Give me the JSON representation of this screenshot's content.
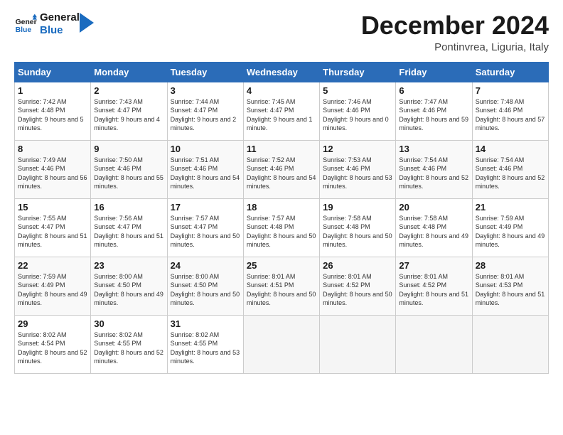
{
  "logo": {
    "text_general": "General",
    "text_blue": "Blue"
  },
  "header": {
    "month": "December 2024",
    "location": "Pontinvrea, Liguria, Italy"
  },
  "weekdays": [
    "Sunday",
    "Monday",
    "Tuesday",
    "Wednesday",
    "Thursday",
    "Friday",
    "Saturday"
  ],
  "weeks": [
    [
      {
        "day": "1",
        "sunrise": "7:42 AM",
        "sunset": "4:48 PM",
        "daylight": "9 hours and 5 minutes."
      },
      {
        "day": "2",
        "sunrise": "7:43 AM",
        "sunset": "4:47 PM",
        "daylight": "9 hours and 4 minutes."
      },
      {
        "day": "3",
        "sunrise": "7:44 AM",
        "sunset": "4:47 PM",
        "daylight": "9 hours and 2 minutes."
      },
      {
        "day": "4",
        "sunrise": "7:45 AM",
        "sunset": "4:47 PM",
        "daylight": "9 hours and 1 minute."
      },
      {
        "day": "5",
        "sunrise": "7:46 AM",
        "sunset": "4:46 PM",
        "daylight": "9 hours and 0 minutes."
      },
      {
        "day": "6",
        "sunrise": "7:47 AM",
        "sunset": "4:46 PM",
        "daylight": "8 hours and 59 minutes."
      },
      {
        "day": "7",
        "sunrise": "7:48 AM",
        "sunset": "4:46 PM",
        "daylight": "8 hours and 57 minutes."
      }
    ],
    [
      {
        "day": "8",
        "sunrise": "7:49 AM",
        "sunset": "4:46 PM",
        "daylight": "8 hours and 56 minutes."
      },
      {
        "day": "9",
        "sunrise": "7:50 AM",
        "sunset": "4:46 PM",
        "daylight": "8 hours and 55 minutes."
      },
      {
        "day": "10",
        "sunrise": "7:51 AM",
        "sunset": "4:46 PM",
        "daylight": "8 hours and 54 minutes."
      },
      {
        "day": "11",
        "sunrise": "7:52 AM",
        "sunset": "4:46 PM",
        "daylight": "8 hours and 54 minutes."
      },
      {
        "day": "12",
        "sunrise": "7:53 AM",
        "sunset": "4:46 PM",
        "daylight": "8 hours and 53 minutes."
      },
      {
        "day": "13",
        "sunrise": "7:54 AM",
        "sunset": "4:46 PM",
        "daylight": "8 hours and 52 minutes."
      },
      {
        "day": "14",
        "sunrise": "7:54 AM",
        "sunset": "4:46 PM",
        "daylight": "8 hours and 52 minutes."
      }
    ],
    [
      {
        "day": "15",
        "sunrise": "7:55 AM",
        "sunset": "4:47 PM",
        "daylight": "8 hours and 51 minutes."
      },
      {
        "day": "16",
        "sunrise": "7:56 AM",
        "sunset": "4:47 PM",
        "daylight": "8 hours and 51 minutes."
      },
      {
        "day": "17",
        "sunrise": "7:57 AM",
        "sunset": "4:47 PM",
        "daylight": "8 hours and 50 minutes."
      },
      {
        "day": "18",
        "sunrise": "7:57 AM",
        "sunset": "4:48 PM",
        "daylight": "8 hours and 50 minutes."
      },
      {
        "day": "19",
        "sunrise": "7:58 AM",
        "sunset": "4:48 PM",
        "daylight": "8 hours and 50 minutes."
      },
      {
        "day": "20",
        "sunrise": "7:58 AM",
        "sunset": "4:48 PM",
        "daylight": "8 hours and 49 minutes."
      },
      {
        "day": "21",
        "sunrise": "7:59 AM",
        "sunset": "4:49 PM",
        "daylight": "8 hours and 49 minutes."
      }
    ],
    [
      {
        "day": "22",
        "sunrise": "7:59 AM",
        "sunset": "4:49 PM",
        "daylight": "8 hours and 49 minutes."
      },
      {
        "day": "23",
        "sunrise": "8:00 AM",
        "sunset": "4:50 PM",
        "daylight": "8 hours and 49 minutes."
      },
      {
        "day": "24",
        "sunrise": "8:00 AM",
        "sunset": "4:50 PM",
        "daylight": "8 hours and 50 minutes."
      },
      {
        "day": "25",
        "sunrise": "8:01 AM",
        "sunset": "4:51 PM",
        "daylight": "8 hours and 50 minutes."
      },
      {
        "day": "26",
        "sunrise": "8:01 AM",
        "sunset": "4:52 PM",
        "daylight": "8 hours and 50 minutes."
      },
      {
        "day": "27",
        "sunrise": "8:01 AM",
        "sunset": "4:52 PM",
        "daylight": "8 hours and 51 minutes."
      },
      {
        "day": "28",
        "sunrise": "8:01 AM",
        "sunset": "4:53 PM",
        "daylight": "8 hours and 51 minutes."
      }
    ],
    [
      {
        "day": "29",
        "sunrise": "8:02 AM",
        "sunset": "4:54 PM",
        "daylight": "8 hours and 52 minutes."
      },
      {
        "day": "30",
        "sunrise": "8:02 AM",
        "sunset": "4:55 PM",
        "daylight": "8 hours and 52 minutes."
      },
      {
        "day": "31",
        "sunrise": "8:02 AM",
        "sunset": "4:55 PM",
        "daylight": "8 hours and 53 minutes."
      },
      null,
      null,
      null,
      null
    ]
  ]
}
